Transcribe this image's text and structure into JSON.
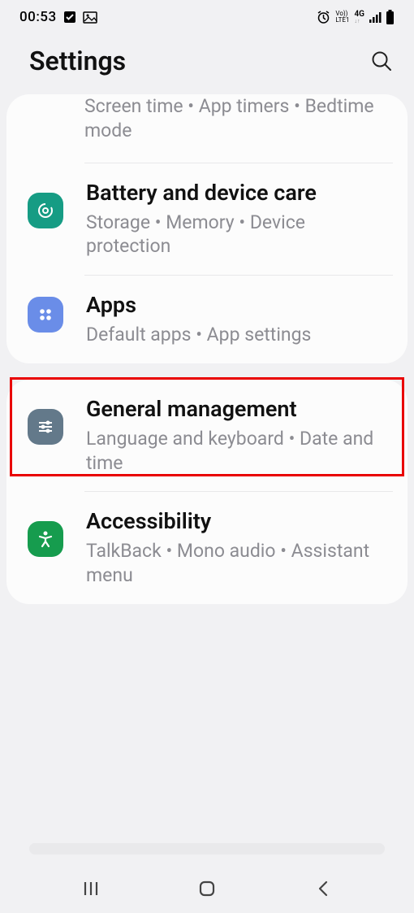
{
  "status": {
    "time": "00:53",
    "network": "4G",
    "lte": "LTE1",
    "vo": "Vo))"
  },
  "header": {
    "title": "Settings"
  },
  "card1": {
    "partial_sub": "Screen time  •  App timers  •  Bedtime mode",
    "battery": {
      "title": "Battery and device care",
      "sub": "Storage  •  Memory  •  Device protection"
    },
    "apps": {
      "title": "Apps",
      "sub": "Default apps  •  App settings"
    }
  },
  "card2": {
    "general": {
      "title": "General management",
      "sub": "Language and keyboard  •  Date and time"
    },
    "accessibility": {
      "title": "Accessibility",
      "sub": "TalkBack  •  Mono audio  •  Assistant menu"
    }
  }
}
